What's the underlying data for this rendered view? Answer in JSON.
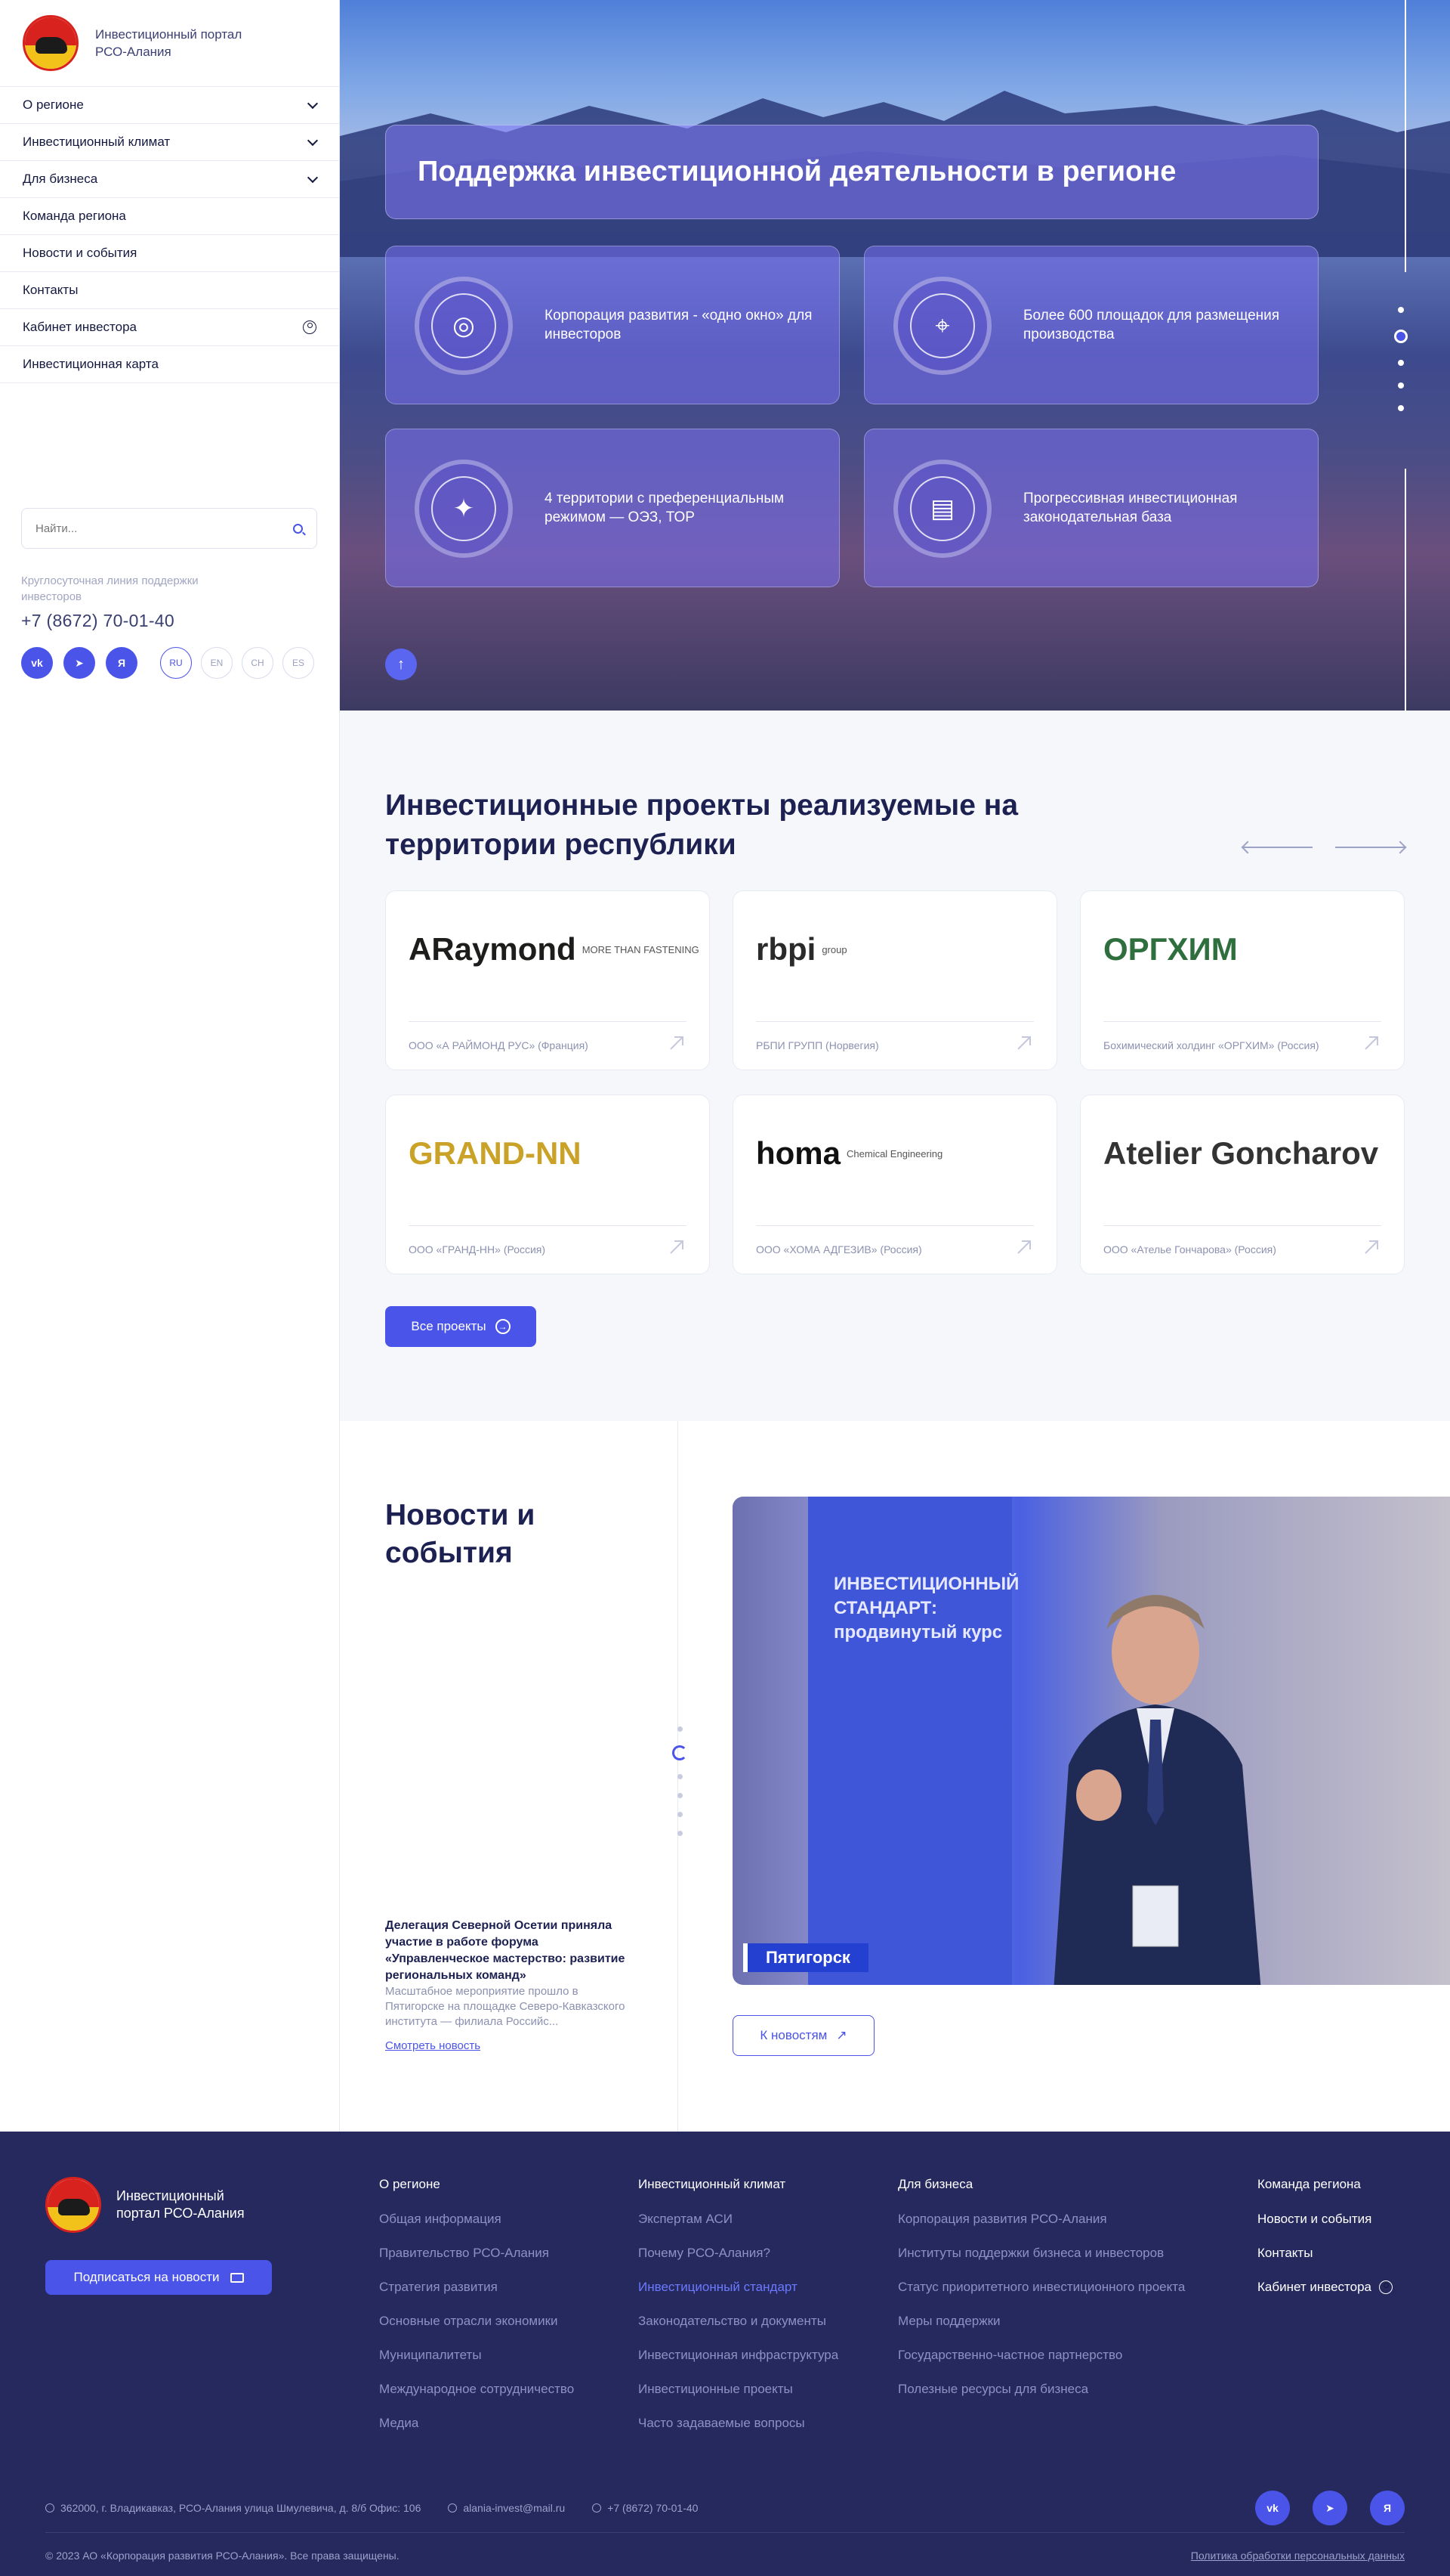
{
  "sidebar": {
    "logo_text": "Инвестиционный портал РСО-Алания",
    "nav": [
      {
        "label": "О регионе",
        "has_chevron": true
      },
      {
        "label": "Инвестиционный климат",
        "has_chevron": true
      },
      {
        "label": "Для бизнеса",
        "has_chevron": true
      },
      {
        "label": "Команда региона"
      },
      {
        "label": "Новости и события"
      },
      {
        "label": "Контакты"
      },
      {
        "label": "Кабинет инвестора",
        "icon": "person-icon"
      },
      {
        "label": "Инвестиционная карта"
      }
    ],
    "search_placeholder": "Найти...",
    "hotline_label": "Круглосуточная линия поддержки инвесторов",
    "phone": "+7 (8672) 70-01-40",
    "social": [
      "vk-icon",
      "telegram-icon",
      "yandex-icon"
    ],
    "social_letters": [
      "vk",
      "➤",
      "Я"
    ],
    "languages": [
      "RU",
      "EN",
      "CH",
      "ES"
    ],
    "active_language": "RU"
  },
  "hero": {
    "title": "Поддержка инвестиционной деятельности в регионе",
    "cards": [
      {
        "text": "Корпорация развития - «одно окно» для инвесторов",
        "icon": "target-icon",
        "glyph": "◎"
      },
      {
        "text": "Более 600 площадок для размещения производства",
        "icon": "map-pin-icon",
        "glyph": "⌖"
      },
      {
        "text": "4 территории с преференциальным режимом — ОЭЗ, ТОР",
        "icon": "sparkle-icon",
        "glyph": "✦"
      },
      {
        "text": "Прогрессивная инвестиционная законодательная база",
        "icon": "document-icon",
        "glyph": "▤"
      }
    ],
    "slide_count": 5,
    "active_slide": 2
  },
  "projects": {
    "title": "Инвестиционные проекты реализуемые на территории республики",
    "items": [
      {
        "logo": "ARaymond",
        "logo_sub": "MORE THAN FASTENING",
        "name": "ООО «А РАЙМОНД РУС» (Франция)",
        "color": "#1d1d1b"
      },
      {
        "logo": "rbpi",
        "logo_sub": "group",
        "name": "РБПИ ГРУПП (Норвегия)",
        "color": "#2a2a2a"
      },
      {
        "logo": "ОРГХИМ",
        "logo_sub": "",
        "name": "Бохимический холдинг «ОРГХИМ» (Россия)",
        "color": "#2f6f3e"
      },
      {
        "logo": "GRAND-NN",
        "logo_sub": "",
        "name": "ООО «ГРАНД-НН» (Россия)",
        "color": "#c9a227"
      },
      {
        "logo": "homa",
        "logo_sub": "Chemical Engineering",
        "name": "ООО «ХОМА АДГЕЗИВ» (Россия)",
        "color": "#111111"
      },
      {
        "logo": "Atelier Goncharov",
        "logo_sub": "",
        "name": "ООО «Ателье Гончарова» (Россия)",
        "color": "#333333"
      }
    ],
    "all_button": "Все проекты"
  },
  "news": {
    "title": "Новости и события",
    "item_title": "Делегация Северной Осетии приняла участие в работе форума «Управленческое мастерство: развитие региональных команд»",
    "item_text": "Масштабное мероприятие прошло в Пятигорске на площадке Северо-Кавказского института — филиала Российс...",
    "more_link": "Смотреть новость",
    "photo_banner_text": "ИНВЕСТИЦИОННЫЙ СТАНДАРТ: продвинутый курс",
    "photo_tag": "Пятигорск",
    "to_news_button": "К новостям",
    "slide_count": 6,
    "active_slide": 1
  },
  "footer": {
    "logo_text": "Инвестиционный портал РСО-Алания",
    "subscribe": "Подписаться на новости",
    "columns": [
      {
        "head": "О регионе",
        "links": [
          "Общая информация",
          "Правительство РСО-Алания",
          "Стратегия развития",
          "Основные отрасли экономики",
          "Муниципалитеты",
          "Международное сотрудничество",
          "Медиа"
        ]
      },
      {
        "head": "Инвестиционный климат",
        "links": [
          "Экспертам АСИ",
          "Почему РСО-Алания?",
          "Инвестиционный стандарт",
          "Законодательство и документы",
          "Инвестиционная инфраструктура",
          "Инвестиционные проекты",
          "Часто задаваемые вопросы"
        ]
      },
      {
        "head": "Для бизнеса",
        "links": [
          "Корпорация развития РСО-Алания",
          "Институты поддержки бизнеса и инвесторов",
          "Статус приоритетного инвестиционного проекта",
          "Меры поддержки",
          "Государственно-частное партнерство",
          "Полезные ресурсы для бизнеса"
        ]
      },
      {
        "head": "Команда региона",
        "links": [
          "Новости и события",
          "Контакты",
          "Кабинет инвестора"
        ]
      }
    ],
    "highlighted_link": "Инвестиционный стандарт",
    "address": "362000, г. Владикавказ, РСО-Алания улица Шмулевича, д. 8/б Офис: 106",
    "email": "alania-invest@mail.ru",
    "phone": "+7 (8672) 70-01-40",
    "copyright": "© 2023 АО «Корпорация развития РСО-Алания». Все права защищены.",
    "policy": "Политика обработки персональных данных"
  }
}
